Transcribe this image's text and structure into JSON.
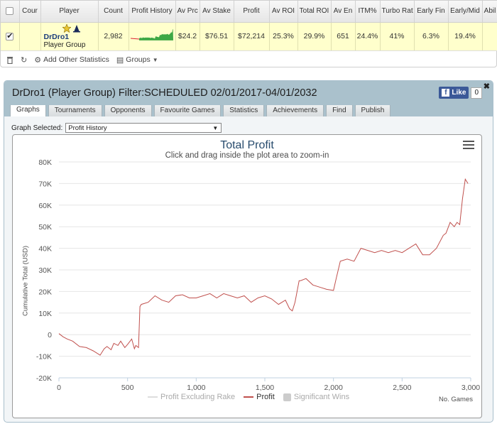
{
  "table": {
    "headers": [
      "",
      "Cour",
      "Player",
      "Count",
      "Profit History",
      "Av Prc",
      "Av Stake",
      "Profit",
      "Av ROI",
      "Total ROI",
      "Av En",
      "ITM%",
      "Turbo Rat",
      "Early Fin",
      "Early/Mid",
      "Abil"
    ],
    "row": {
      "player_name": "DrDro1",
      "player_group": "Player Group",
      "count": "2,982",
      "av_prize": "$24.2",
      "av_stake": "$76.51",
      "profit": "$72,214",
      "av_roi": "25.3%",
      "total_roi": "29.9%",
      "av_entrants": "651",
      "itm": "24.4%",
      "turbo_ratio": "41%",
      "early_finish": "6.3%",
      "early_mid": "19.4%",
      "ability": ""
    }
  },
  "toolbar": {
    "add_stats_label": "Add Other Statistics",
    "groups_label": "Groups"
  },
  "panel": {
    "title": "DrDro1 (Player Group) Filter:SCHEDULED 02/01/2017-04/01/2032",
    "like_label": "Like",
    "like_count": "0",
    "tabs": [
      "Graphs",
      "Tournaments",
      "Opponents",
      "Favourite Games",
      "Statistics",
      "Achievements",
      "Find",
      "Publish"
    ],
    "graph_selected_label": "Graph Selected:",
    "graph_selected_value": "Profit History"
  },
  "chart_data": {
    "type": "line",
    "title": "Total Profit",
    "subtitle": "Click and drag inside the plot area to zoom-in",
    "xlabel": "No. Games",
    "ylabel": "Cumulative Total (USD)",
    "xlim": [
      0,
      3000
    ],
    "ylim": [
      -20000,
      80000
    ],
    "x_ticks": [
      "0",
      "500",
      "1,000",
      "1,500",
      "2,000",
      "2,500",
      "3,000"
    ],
    "y_ticks": [
      "-20K",
      "-10K",
      "0",
      "10K",
      "20K",
      "30K",
      "40K",
      "50K",
      "60K",
      "70K",
      "80K"
    ],
    "legend": [
      "Profit Excluding Rake",
      "Profit",
      "Significant Wins"
    ],
    "colors": {
      "profit": "#c0504d",
      "excl_rake": "#dddddd",
      "sig_wins": "#cccccc"
    },
    "series": [
      {
        "name": "Profit",
        "x": [
          0,
          30,
          60,
          100,
          150,
          200,
          250,
          300,
          330,
          350,
          380,
          400,
          430,
          450,
          480,
          500,
          530,
          550,
          560,
          580,
          590,
          600,
          650,
          700,
          750,
          800,
          850,
          900,
          950,
          1000,
          1050,
          1100,
          1150,
          1200,
          1250,
          1300,
          1350,
          1400,
          1450,
          1500,
          1550,
          1600,
          1650,
          1680,
          1700,
          1720,
          1750,
          1760,
          1800,
          1850,
          1900,
          1950,
          2000,
          2020,
          2050,
          2100,
          2150,
          2200,
          2250,
          2300,
          2350,
          2400,
          2450,
          2500,
          2550,
          2600,
          2650,
          2700,
          2750,
          2800,
          2820,
          2850,
          2880,
          2900,
          2920,
          2940,
          2960,
          2980
        ],
        "y": [
          500,
          -1000,
          -2000,
          -3000,
          -5500,
          -6000,
          -7500,
          -9500,
          -6500,
          -5500,
          -7000,
          -4000,
          -5000,
          -3000,
          -6000,
          -4500,
          -2000,
          -6500,
          -5000,
          -6000,
          13000,
          14000,
          15000,
          18000,
          16000,
          15000,
          18000,
          18500,
          17000,
          17000,
          18000,
          19000,
          17000,
          19000,
          18000,
          17000,
          18000,
          15000,
          17000,
          18000,
          16500,
          14000,
          16000,
          12000,
          11000,
          15000,
          25000,
          25000,
          26000,
          23000,
          22000,
          21000,
          20500,
          26000,
          34000,
          35000,
          34000,
          40000,
          39000,
          38000,
          39000,
          38000,
          39000,
          38000,
          40000,
          42000,
          37000,
          37000,
          40000,
          46000,
          47000,
          52000,
          50000,
          52000,
          51000,
          63000,
          72000,
          70000
        ]
      }
    ]
  }
}
